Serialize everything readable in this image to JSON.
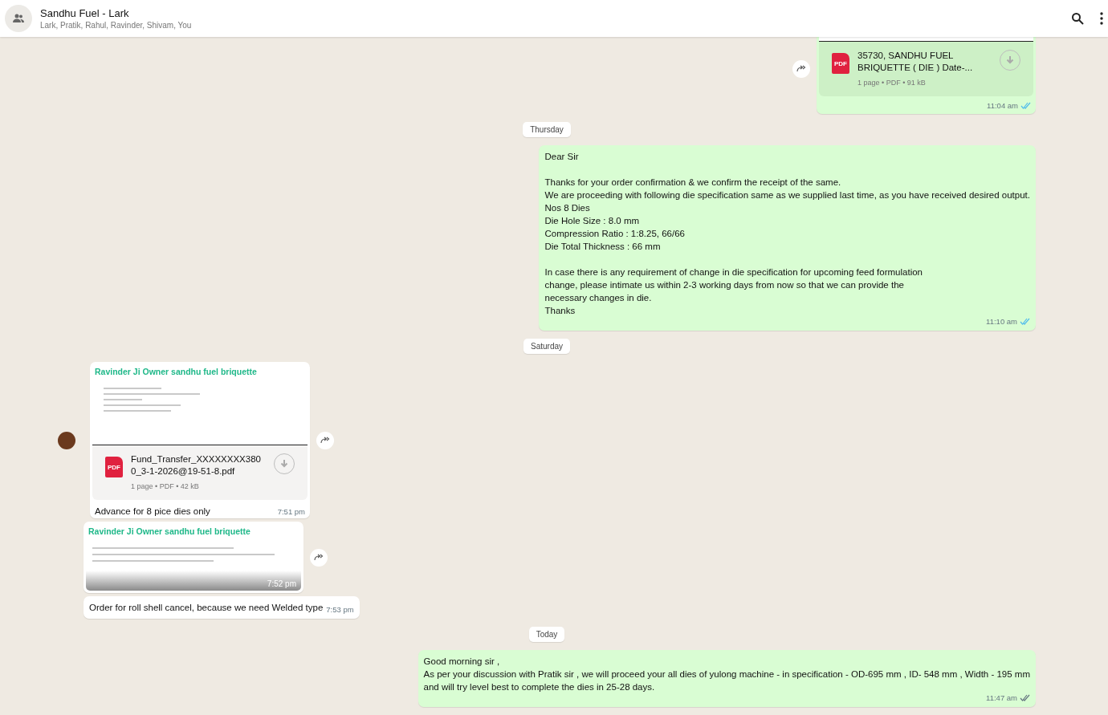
{
  "header": {
    "title": "Sandhu Fuel - Lark",
    "subtitle": "Lark, Pratik, Rahul, Ravinder, Shivam, You"
  },
  "messages": [
    {
      "kind": "document",
      "outgoing": true,
      "file_name": "35730, SANDHU FUEL BRIQUETTE ( DIE ) Date-...",
      "file_meta": "1 page • PDF • 91 kB",
      "file_type": "PDF",
      "time": "11:04 am",
      "read": true
    },
    {
      "kind": "date",
      "label": "Thursday"
    },
    {
      "kind": "text",
      "outgoing": true,
      "paragraphs": [
        [
          "Dear Sir"
        ],
        [
          "Thanks for your order confirmation & we confirm the receipt of the same.",
          "We are proceeding with following die specification same as we supplied last time, as you have received desired output.",
          "Nos 8 Dies",
          "Die Hole Size : 8.0 mm",
          "Compression Ratio : 1:8.25, 66/66",
          "Die Total Thickness : 66 mm"
        ],
        [
          "In case there is any requirement of change in die specification for upcoming feed formulation",
          "change, please intimate us within 2-3 working days from now so that we can provide the",
          "necessary changes in die.",
          "Thanks"
        ]
      ],
      "time": "11:10 am",
      "read": true
    },
    {
      "kind": "date",
      "label": "Saturday"
    },
    {
      "kind": "document",
      "outgoing": false,
      "sender": "Ravinder Ji Owner sandhu fuel briquette",
      "file_name": "Fund_Transfer_XXXXXXXX3800_3-1-2026@19-51-8.pdf",
      "file_meta": "1 page • PDF • 42 kB",
      "file_type": "PDF",
      "caption": "Advance for 8 pice dies only",
      "time": "7:51 pm"
    },
    {
      "kind": "image",
      "outgoing": false,
      "sender": "Ravinder Ji Owner sandhu fuel briquette",
      "time": "7:52 pm"
    },
    {
      "kind": "text",
      "outgoing": false,
      "paragraphs": [
        [
          "Order for roll shell cancel, because we need Welded type"
        ]
      ],
      "time": "7:53 pm"
    },
    {
      "kind": "date",
      "label": "Today"
    },
    {
      "kind": "text",
      "outgoing": true,
      "paragraphs": [
        [
          "Good morning sir ,",
          "As per your discussion with Pratik sir , we will proceed your all dies of yulong machine - in specification - OD-695 mm , ID- 548 mm , Width - 195 mm",
          "and will try level best to complete the dies in 25-28 days."
        ]
      ],
      "time": "11:47 am",
      "read": false
    }
  ]
}
